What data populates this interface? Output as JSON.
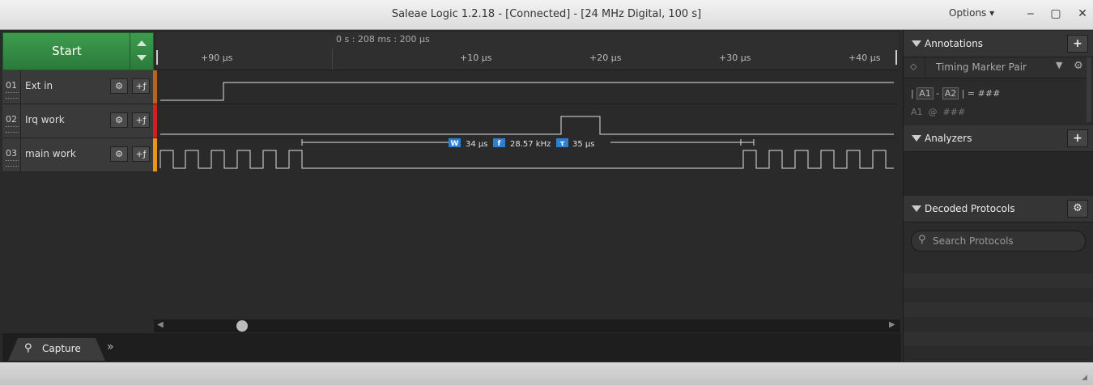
{
  "window": {
    "title": "Saleae Logic 1.2.18 - [Connected] - [24 MHz Digital, 100 s]",
    "options_label": "Options",
    "minimize": "‒",
    "maximize": "▢",
    "close": "✕"
  },
  "control": {
    "start_label": "Start"
  },
  "channels": [
    {
      "num": "01",
      "name": "Ext in",
      "color": "#b5651d"
    },
    {
      "num": "02",
      "name": "Irq work",
      "color": "#d21f1f"
    },
    {
      "num": "03",
      "name": "main work",
      "color": "#e8951a"
    }
  ],
  "channel_buttons": {
    "settings": "⚙",
    "trigger": "+ƒ"
  },
  "timeline": {
    "absolute": "0 s : 208 ms : 200 µs",
    "ticks": [
      "+90 µs",
      "+10 µs",
      "+20 µs",
      "+30 µs",
      "+40 µs"
    ]
  },
  "measurement": {
    "width_badge": "W",
    "width": "34 µs",
    "freq_badge": "f",
    "freq": "28.57 kHz",
    "period_badge": "τ",
    "period": "35 µs"
  },
  "tabs": {
    "capture": "Capture",
    "more": "»"
  },
  "annotations": {
    "title": "Annotations",
    "add": "+",
    "marker": "Timing Marker Pair",
    "formula_a1": "A1",
    "formula_a2": "A2",
    "formula_value": "###",
    "at_value": "###"
  },
  "analyzers": {
    "title": "Analyzers",
    "add": "+"
  },
  "decoded": {
    "title": "Decoded Protocols",
    "search_placeholder": "Search Protocols"
  },
  "colors": {
    "accent_green": "#2b7a3a",
    "badge_blue": "#2f7fd1"
  }
}
